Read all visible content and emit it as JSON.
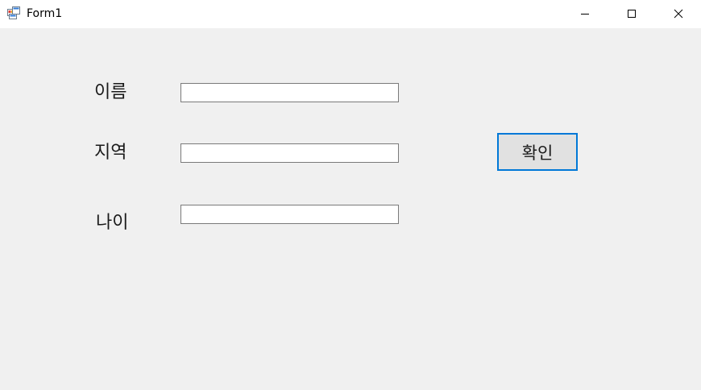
{
  "window": {
    "title": "Form1",
    "icon": "winforms-app-icon",
    "controls": {
      "minimize": "minimize-icon",
      "maximize": "maximize-icon",
      "close": "close-icon"
    }
  },
  "form": {
    "fields": [
      {
        "label": "이름",
        "value": "",
        "placeholder": ""
      },
      {
        "label": "지역",
        "value": "",
        "placeholder": ""
      },
      {
        "label": "나이",
        "value": "",
        "placeholder": ""
      }
    ],
    "confirm_button": "확인"
  },
  "colors": {
    "client_background": "#f0f0f0",
    "titlebar_background": "#ffffff",
    "button_focus_border": "#0078d7",
    "button_face": "#e1e1e1",
    "textbox_border": "#7a7a7a"
  }
}
